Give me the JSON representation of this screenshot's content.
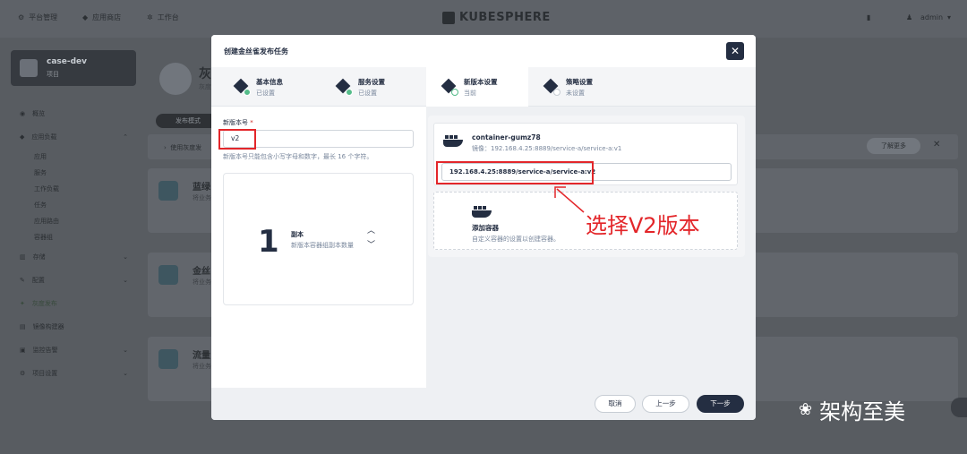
{
  "topnav": {
    "items": [
      {
        "label": "平台管理",
        "icon": "gear-icon"
      },
      {
        "label": "应用商店",
        "icon": "store-icon"
      },
      {
        "label": "工作台",
        "icon": "workbench-icon"
      }
    ],
    "logo": "KUBESPHERE",
    "user": "admin"
  },
  "sidebar": {
    "project_name": "case-dev",
    "project_type": "项目",
    "menu": [
      {
        "label": "概览"
      },
      {
        "label": "应用负载"
      },
      {
        "label": "应用"
      },
      {
        "label": "服务"
      },
      {
        "label": "工作负载"
      },
      {
        "label": "任务"
      },
      {
        "label": "应用路由"
      },
      {
        "label": "容器组"
      },
      {
        "label": "存储"
      },
      {
        "label": "配置"
      },
      {
        "label": "灰度发布"
      },
      {
        "label": "镜像构建器"
      },
      {
        "label": "监控告警"
      },
      {
        "label": "项目设置"
      }
    ]
  },
  "background": {
    "title": "灰",
    "subtitle": "灰度",
    "tab": "发布模式",
    "strip_text": "使用灰度发",
    "learn_more": "了解更多",
    "cards": [
      {
        "title": "蓝绿",
        "sub": "将业务"
      },
      {
        "title": "金丝",
        "sub": "将业务"
      },
      {
        "title": "流量",
        "sub": "将业务"
      }
    ]
  },
  "modal": {
    "title": "创建金丝雀发布任务",
    "steps": [
      {
        "name": "基本信息",
        "status": "已设置"
      },
      {
        "name": "服务设置",
        "status": "已设置"
      },
      {
        "name": "新版本设置",
        "status": "当前"
      },
      {
        "name": "策略设置",
        "status": "未设置"
      }
    ],
    "version_label": "新版本号",
    "version_value": "v2",
    "version_desc": "新版本号只能包含小写字母和数字，最长 16 个字符。",
    "replica": {
      "count": "1",
      "label": "副本",
      "desc": "新版本容器组副本数量"
    },
    "container": {
      "name": "container-gumz78",
      "image_prefix": "镜像：",
      "image_current": "192.168.4.25:8889/service-a/service-a:v1",
      "image_input": "192.168.4.25:8889/service-a/service-a:v2"
    },
    "add_container": {
      "title": "添加容器",
      "desc": "自定义容器的设置以创建容器。"
    },
    "footer": {
      "cancel": "取消",
      "prev": "上一步",
      "next": "下一步"
    }
  },
  "annotation": "选择V2版本",
  "watermark": "架构至美",
  "colors": {
    "highlight": "#e3262a",
    "accent": "#55bc8a",
    "primary": "#242e42"
  }
}
